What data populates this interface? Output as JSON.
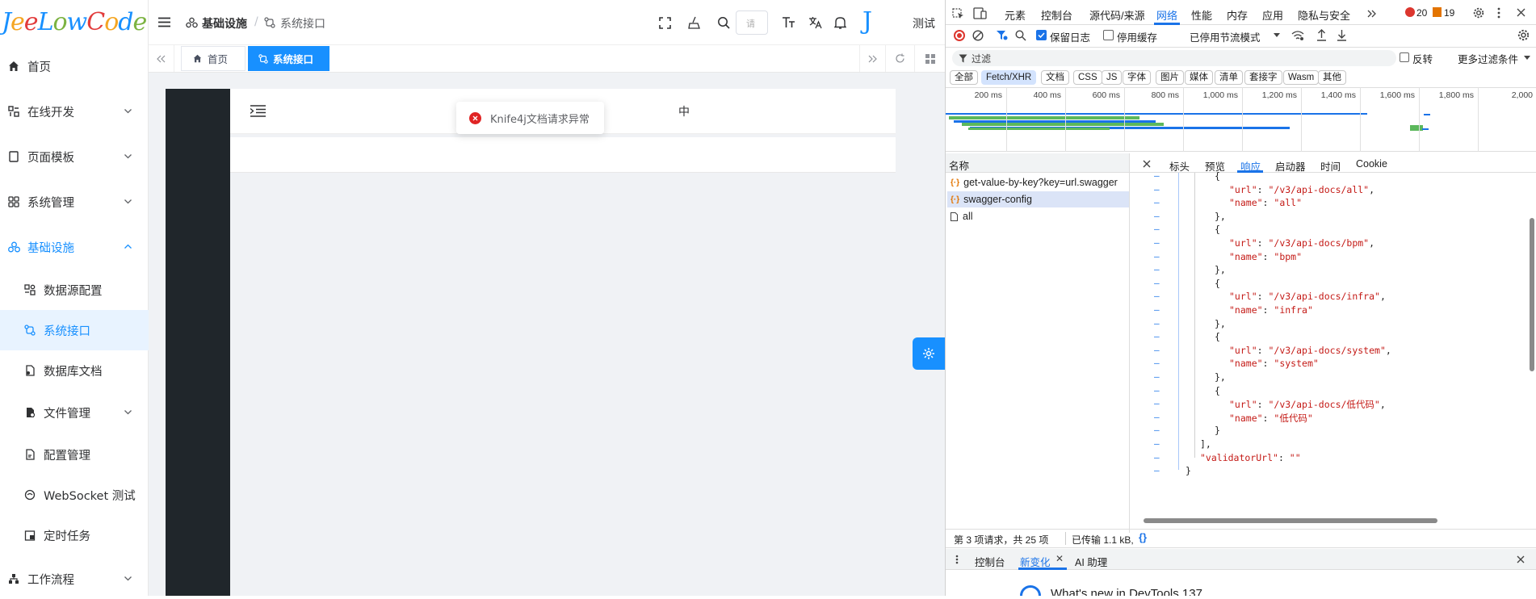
{
  "app": {
    "logo_text": "JeeLowCode"
  },
  "sidebar": {
    "items": [
      {
        "label": "首页",
        "icon": "home-icon"
      },
      {
        "label": "在线开发",
        "icon": "dev-icon"
      },
      {
        "label": "页面模板",
        "icon": "template-icon"
      },
      {
        "label": "系统管理",
        "icon": "grid-icon"
      },
      {
        "label": "基础设施",
        "icon": "infra-icon"
      },
      {
        "label": "工作流程",
        "icon": "workflow-icon"
      }
    ],
    "sub_items": [
      {
        "label": "数据源配置"
      },
      {
        "label": "系统接口"
      },
      {
        "label": "数据库文档"
      },
      {
        "label": "文件管理"
      },
      {
        "label": "配置管理"
      },
      {
        "label": "WebSocket 测试"
      },
      {
        "label": "定时任务"
      }
    ]
  },
  "header": {
    "breadcrumb_root": "基础设施",
    "breadcrumb_sep": "/",
    "breadcrumb_current": "系统接口",
    "search_placeholder": "请",
    "user_name": "测试"
  },
  "tabs": [
    {
      "label": "首页"
    },
    {
      "label": "系统接口"
    }
  ],
  "content": {
    "toast_message": "Knife4j文档请求异常",
    "lang_char": "中"
  },
  "devtools": {
    "tabs": [
      "元素",
      "控制台",
      "源代码/来源",
      "网络",
      "性能",
      "内存",
      "应用",
      "隐私与安全"
    ],
    "active_tab": "网络",
    "error_count": "20",
    "warn_count": "19",
    "preserve_log": "保留日志",
    "disable_cache": "停用缓存",
    "throttle": "已停用节流模式",
    "filter_placeholder": "过滤",
    "invert": "反转",
    "more_filters": "更多过滤条件",
    "type_filters": [
      "全部",
      "Fetch/XHR",
      "文档",
      "CSS",
      "JS",
      "字体",
      "图片",
      "媒体",
      "清单",
      "套接字",
      "Wasm",
      "其他"
    ],
    "timeline_ticks": [
      "200 ms",
      "400 ms",
      "600 ms",
      "800 ms",
      "1,000 ms",
      "1,200 ms",
      "1,400 ms",
      "1,600 ms",
      "1,800 ms",
      "2,000"
    ],
    "name_header": "名称",
    "requests": [
      {
        "name": "get-value-by-key?key=url.swagger"
      },
      {
        "name": "swagger-config"
      },
      {
        "name": "all"
      }
    ],
    "detail_tabs": [
      "标头",
      "预览",
      "响应",
      "启动器",
      "时间",
      "Cookie"
    ],
    "active_detail_tab": "响应",
    "response_lines": [
      "{",
      "    \"url\": \"/v3/api-docs/all\",",
      "    \"name\": \"all\"",
      "},",
      "{",
      "    \"url\": \"/v3/api-docs/bpm\",",
      "    \"name\": \"bpm\"",
      "},",
      "{",
      "    \"url\": \"/v3/api-docs/infra\",",
      "    \"name\": \"infra\"",
      "},",
      "{",
      "    \"url\": \"/v3/api-docs/system\",",
      "    \"name\": \"system\"",
      "},",
      "{",
      "    \"url\": \"/v3/api-docs/低代码\",",
      "    \"name\": \"低代码\"",
      "}",
      "],",
      "\"validatorUrl\": \"\"",
      "}"
    ],
    "status_requests": "第 3 项请求，共 25 项",
    "status_transferred": "已传输 1.1 kB,",
    "drawer_tabs": [
      "控制台",
      "新变化",
      "AI 助理"
    ],
    "drawer_active": "新变化",
    "drawer_preview": "What's new in DevTools 137"
  }
}
